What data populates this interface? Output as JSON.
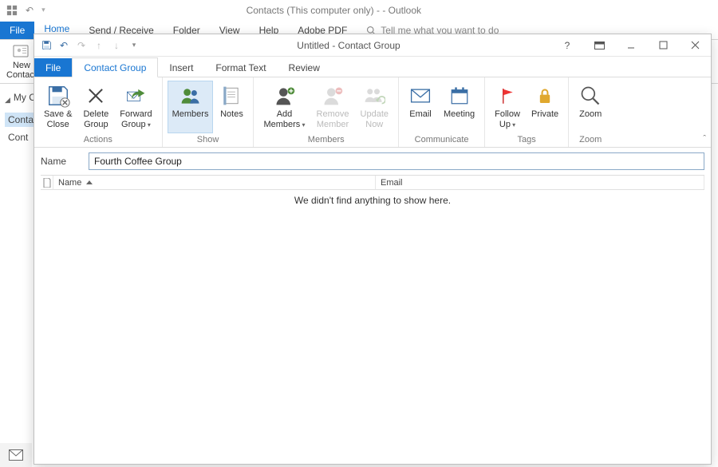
{
  "bg": {
    "title": "Contacts (This computer only) -                         - Outlook",
    "tabs": {
      "file": "File",
      "home": "Home",
      "send": "Send / Receive",
      "folder": "Folder",
      "view": "View",
      "help": "Help",
      "adobe": "Adobe PDF",
      "tell": "Tell me what you want to do"
    },
    "new_contact_btn": "New\nContact",
    "nav": {
      "section": "My C",
      "selected": "Conta",
      "item": "Cont"
    }
  },
  "fg": {
    "title": "Untitled  -  Contact Group",
    "tabs": {
      "file": "File",
      "contact_group": "Contact Group",
      "insert": "Insert",
      "format_text": "Format Text",
      "review": "Review"
    },
    "ribbon": {
      "actions": {
        "save_close": "Save &\nClose",
        "delete_group": "Delete\nGroup",
        "forward_group": "Forward\nGroup",
        "label": "Actions"
      },
      "show": {
        "members": "Members",
        "notes": "Notes",
        "label": "Show"
      },
      "members": {
        "add": "Add\nMembers",
        "remove": "Remove\nMember",
        "update": "Update\nNow",
        "label": "Members"
      },
      "communicate": {
        "email": "Email",
        "meeting": "Meeting",
        "label": "Communicate"
      },
      "tags": {
        "follow_up": "Follow\nUp",
        "private": "Private",
        "label": "Tags"
      },
      "zoom": {
        "zoom": "Zoom",
        "label": "Zoom"
      }
    },
    "name_label": "Name",
    "name_value": "Fourth Coffee Group",
    "grid": {
      "col_name": "Name",
      "col_email": "Email",
      "empty": "We didn't find anything to show here."
    }
  }
}
